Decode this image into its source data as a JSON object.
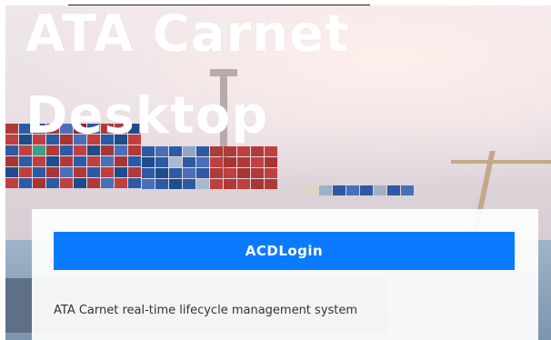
{
  "hero": {
    "title_line1": "ATA Carnet",
    "title_line2": "Desktop"
  },
  "card": {
    "login_label": "ACDLogin",
    "subtitle": "ATA Carnet real-time lifecycle management system"
  },
  "colors": {
    "accent": "#0a7bff",
    "title_text": "#ffffff",
    "subtitle_text": "#333333"
  }
}
